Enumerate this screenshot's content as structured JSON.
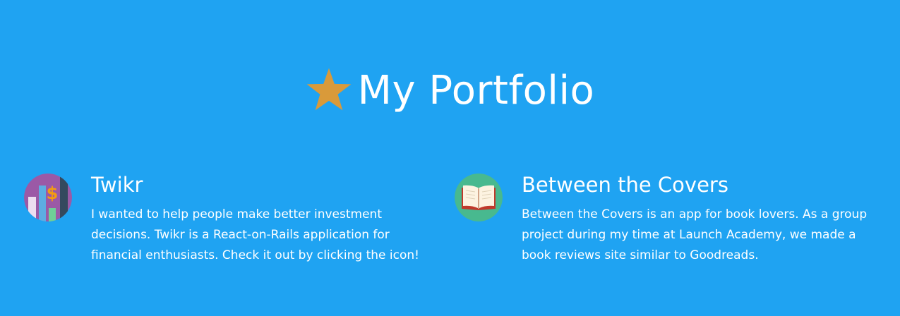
{
  "section": {
    "title": "My Portfolio",
    "title_icon": "star-icon",
    "background_color": "#1fa3f2",
    "star_color": "#d99a3a"
  },
  "projects": [
    {
      "name": "Twikr",
      "icon": "finance-chart-icon",
      "description": "I wanted to help people make better investment decisions. Twikr is a React-on-Rails application for financial enthusiasts. Check it out by clicking the icon!"
    },
    {
      "name": "Between the Covers",
      "icon": "open-book-icon",
      "description": "Between the Covers is an app for book lovers. As a group project during my time at Launch Academy, we made a book reviews site similar to Goodreads."
    }
  ]
}
